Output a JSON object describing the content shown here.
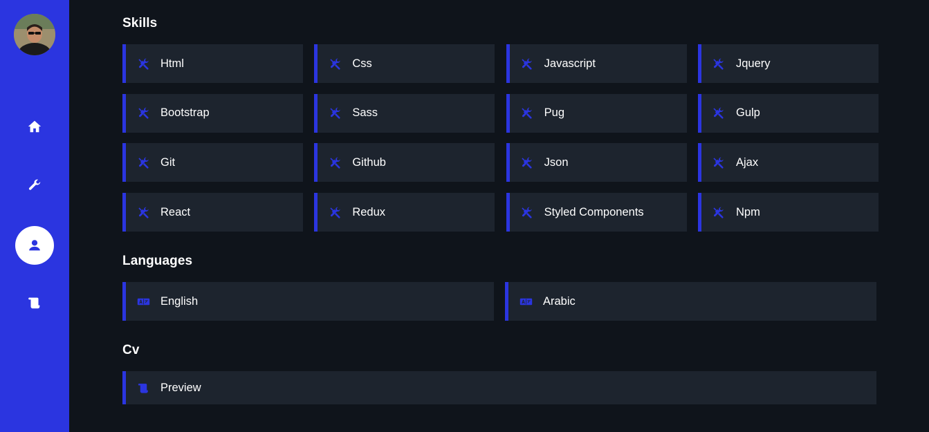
{
  "colors": {
    "accent": "#2b35e0",
    "background": "#0f141b",
    "card": "#1d242e",
    "text": "#ffffff"
  },
  "sidebar": {
    "avatar": {
      "icon": "avatar"
    },
    "items": [
      {
        "icon": "home-icon",
        "active": false
      },
      {
        "icon": "wrench-icon",
        "active": false
      },
      {
        "icon": "user-icon",
        "active": true
      },
      {
        "icon": "scroll-icon",
        "active": false
      }
    ]
  },
  "skills": {
    "title": "Skills",
    "icon": "tools-icon",
    "items": [
      "Html",
      "Css",
      "Javascript",
      "Jquery",
      "Bootstrap",
      "Sass",
      "Pug",
      "Gulp",
      "Git",
      "Github",
      "Json",
      "Ajax",
      "React",
      "Redux",
      "Styled Components",
      "Npm"
    ]
  },
  "languages": {
    "title": "Languages",
    "icon": "language-icon",
    "items": [
      "English",
      "Arabic"
    ]
  },
  "cv": {
    "title": "Cv",
    "icon": "scroll-icon",
    "items": [
      "Preview"
    ]
  }
}
